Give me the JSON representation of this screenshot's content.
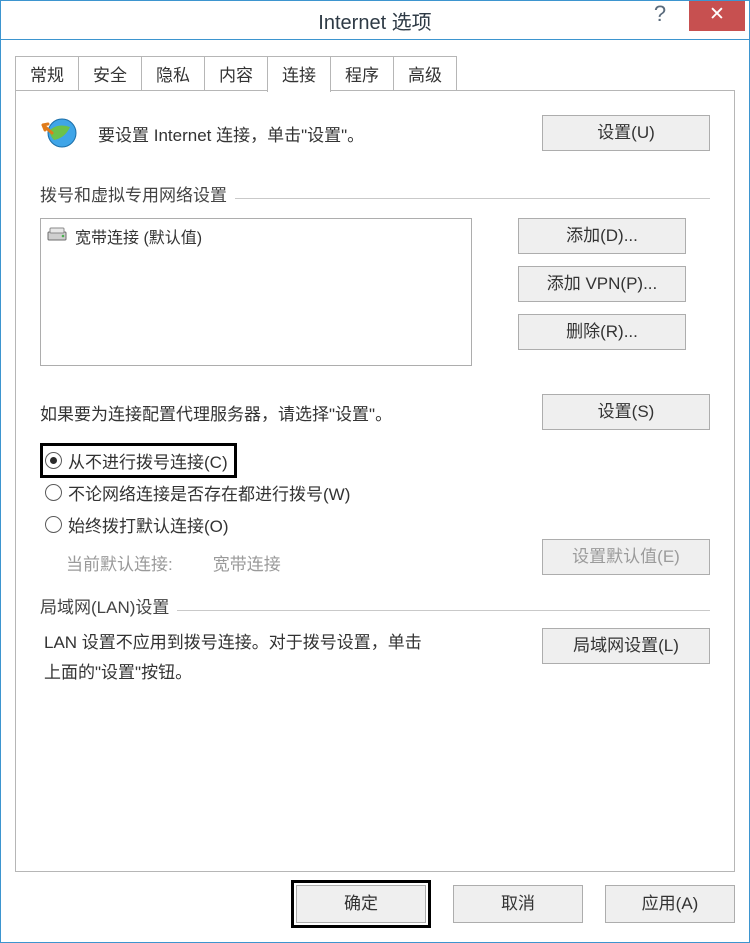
{
  "title": "Internet 选项",
  "tabs": [
    "常规",
    "安全",
    "隐私",
    "内容",
    "连接",
    "程序",
    "高级"
  ],
  "active_tab_index": 4,
  "intro_text": "要设置 Internet 连接，单击\"设置\"。",
  "setup_button": "设置(U)",
  "dial_section_title": "拨号和虚拟专用网络设置",
  "connection_item": "宽带连接 (默认值)",
  "add_button": "添加(D)...",
  "add_vpn_button": "添加 VPN(P)...",
  "remove_button": "删除(R)...",
  "proxy_hint": "如果要为连接配置代理服务器，请选择\"设置\"。",
  "settings_button": "设置(S)",
  "radio_never": "从不进行拨号连接(C)",
  "radio_when_needed": "不论网络连接是否存在都进行拨号(W)",
  "radio_always": "始终拨打默认连接(O)",
  "current_default_label": "当前默认连接:",
  "current_default_value": "宽带连接",
  "set_default_button": "设置默认值(E)",
  "lan_section_title": "局域网(LAN)设置",
  "lan_text": "LAN 设置不应用到拨号连接。对于拨号设置，单击上面的\"设置\"按钮。",
  "lan_button": "局域网设置(L)",
  "ok": "确定",
  "cancel": "取消",
  "apply": "应用(A)"
}
